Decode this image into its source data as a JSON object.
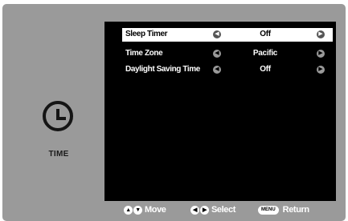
{
  "side": {
    "icon": "clock-icon",
    "label": "TIME"
  },
  "menu": {
    "rows": [
      {
        "label": "Sleep Timer",
        "value": "Off",
        "selected": true
      },
      {
        "label": "Time Zone",
        "value": "Pacific",
        "selected": false
      },
      {
        "label": "Daylight Saving Time",
        "value": "Off",
        "selected": false
      }
    ]
  },
  "footer": {
    "move_label": "Move",
    "select_label": "Select",
    "menu_key": "MENU",
    "return_label": "Return"
  },
  "colors": {
    "frame": "#9a9a9a",
    "panel": "#000000",
    "selected_row": "#ffffff"
  }
}
